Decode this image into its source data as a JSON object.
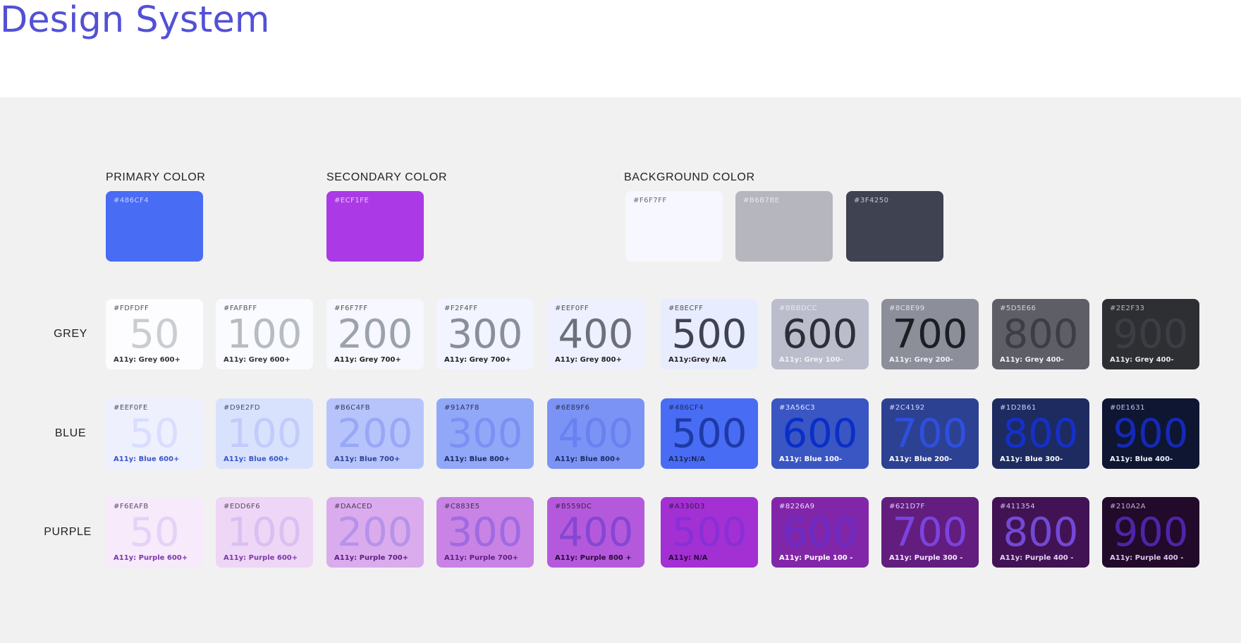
{
  "title": "Design System",
  "sections": {
    "primary": {
      "label": "PRIMARY COLOR",
      "swatches": [
        {
          "hex": "#486CF4",
          "color": "#486CF4",
          "text": "#c8d2ff"
        }
      ]
    },
    "secondary": {
      "label": "SECONDARY COLOR",
      "swatches": [
        {
          "hex": "#ECF1FE",
          "color": "#AB3AE6",
          "text": "#e7c8f7"
        }
      ]
    },
    "background": {
      "label": "BACKGROUND COLOR",
      "swatches": [
        {
          "hex": "#F6F7FF",
          "color": "#F6F7FF",
          "text": "#666b78"
        },
        {
          "hex": "#B6B7BE",
          "color": "#B6B7BE",
          "text": "#e6e7ec"
        },
        {
          "hex": "#3F4250",
          "color": "#3F4250",
          "text": "#c5c7d0"
        }
      ]
    }
  },
  "palettes": [
    {
      "label": "GREY",
      "swatches": [
        {
          "hex": "#FDFDFF",
          "num": "50",
          "ally": "A11y: Grey 600+",
          "bg": "#FDFDFF",
          "numColor": "#cacdd2",
          "hexColor": "#555",
          "allyColor": "#333"
        },
        {
          "hex": "#FAFBFF",
          "num": "100",
          "ally": "A11y: Grey 600+",
          "bg": "#FAFBFF",
          "numColor": "#b7bcc3",
          "hexColor": "#555",
          "allyColor": "#333"
        },
        {
          "hex": "#F6F7FF",
          "num": "200",
          "ally": "A11y: Grey 700+",
          "bg": "#F6F7FF",
          "numColor": "#9ca2ab",
          "hexColor": "#555",
          "allyColor": "#222"
        },
        {
          "hex": "#F2F4FF",
          "num": "300",
          "ally": "A11y: Grey 700+",
          "bg": "#F2F4FF",
          "numColor": "#888f99",
          "hexColor": "#555",
          "allyColor": "#222"
        },
        {
          "hex": "#EEF0FF",
          "num": "400",
          "ally": "A11y: Grey 800+",
          "bg": "#EEF0FF",
          "numColor": "#6b717b",
          "hexColor": "#555",
          "allyColor": "#222"
        },
        {
          "hex": "#E8ECFF",
          "num": "500",
          "ally": "A11y:Grey N/A",
          "bg": "#E8ECFF",
          "numColor": "#3f4250",
          "hexColor": "#555",
          "allyColor": "#222"
        },
        {
          "hex": "#BBBDCC",
          "num": "600",
          "ally": "A11y: Grey 100-",
          "bg": "#BBBDCC",
          "numColor": "#2d2f38",
          "hexColor": "#e8e8ee",
          "allyColor": "#f0f0f5"
        },
        {
          "hex": "#8C8E99",
          "num": "700",
          "ally": "A11y: Grey 200-",
          "bg": "#8C8E99",
          "numColor": "#1d1e24",
          "hexColor": "#e2e2ea",
          "allyColor": "#f0f0f5"
        },
        {
          "hex": "#5D5E66",
          "num": "800",
          "ally": "A11y: Grey 400-",
          "bg": "#5D5E66",
          "numColor": "#3d3e45",
          "hexColor": "#d5d5dc",
          "allyColor": "#f0f0f5"
        },
        {
          "hex": "#2E2F33",
          "num": "900",
          "ally": "A11y: Grey 400-",
          "bg": "#2E2F33",
          "numColor": "#3c3e45",
          "hexColor": "#b9bac2",
          "allyColor": "#e8e8ee"
        }
      ]
    },
    {
      "label": "BLUE",
      "swatches": [
        {
          "hex": "#EEF0FE",
          "num": "50",
          "ally": "A11y: Blue 600+",
          "bg": "#EEF0FE",
          "numColor": "#d9deff",
          "hexColor": "#4a4e66",
          "allyColor": "#3b56c3"
        },
        {
          "hex": "#D9E2FD",
          "num": "100",
          "ally": "A11y: Blue 600+",
          "bg": "#D9E2FD",
          "numColor": "#c2ccfb",
          "hexColor": "#4a4e66",
          "allyColor": "#3b56c3"
        },
        {
          "hex": "#B6C4FB",
          "num": "200",
          "ally": "A11y: Blue 700+",
          "bg": "#B6C4FB",
          "numColor": "#98a8f6",
          "hexColor": "#3a3e58",
          "allyColor": "#2c4192"
        },
        {
          "hex": "#91A7F8",
          "num": "300",
          "ally": "A11y: Blue 800+",
          "bg": "#91A7F8",
          "numColor": "#7b90f3",
          "hexColor": "#2d3150",
          "allyColor": "#1d2b61"
        },
        {
          "hex": "#6E89F6",
          "num": "400",
          "ally": "A11y: Blue 800+",
          "bg": "#7B93F5",
          "numColor": "#6881f0",
          "hexColor": "#2d3150",
          "allyColor": "#1d2b61"
        },
        {
          "hex": "#486CF4",
          "num": "500",
          "ally": "A11y:N/A",
          "bg": "#486CF4",
          "numColor": "#1e3aa8",
          "hexColor": "#1e2a5a",
          "allyColor": "#1d2b61"
        },
        {
          "hex": "#3A56C3",
          "num": "600",
          "ally": "A11y: Blue 100-",
          "bg": "#3A56C3",
          "numColor": "#0a2fc8",
          "hexColor": "#dfe5ff",
          "allyColor": "#ffffff"
        },
        {
          "hex": "#2C4192",
          "num": "700",
          "ally": "A11y: Blue 200-",
          "bg": "#2C4192",
          "numColor": "#2f4fe0",
          "hexColor": "#d3dbff",
          "allyColor": "#ffffff"
        },
        {
          "hex": "#1D2B61",
          "num": "800",
          "ally": "A11y: Blue 300-",
          "bg": "#1D2B61",
          "numColor": "#1530c9",
          "hexColor": "#c8d2ff",
          "allyColor": "#ffffff"
        },
        {
          "hex": "#0E1631",
          "num": "900",
          "ally": "A11y: Blue 400-",
          "bg": "#0E1631",
          "numColor": "#1529b8",
          "hexColor": "#b9c3f2",
          "allyColor": "#f0f3ff"
        }
      ]
    },
    {
      "label": "PURPLE",
      "swatches": [
        {
          "hex": "#F6EAFB",
          "num": "50",
          "ally": "A11y: Purple 600+",
          "bg": "#F6EAFB",
          "numColor": "#e6d2f6",
          "hexColor": "#5b4a66",
          "allyColor": "#7b3aa6"
        },
        {
          "hex": "#EDD6F6",
          "num": "100",
          "ally": "A11y: Purple 600+",
          "bg": "#EDD6F6",
          "numColor": "#d9c0f2",
          "hexColor": "#5b4a66",
          "allyColor": "#7b3aa6"
        },
        {
          "hex": "#DAACED",
          "num": "200",
          "ally": "A11y: Purple 700+",
          "bg": "#DAACED",
          "numColor": "#b792ea",
          "hexColor": "#4c3a58",
          "allyColor": "#5f1d7f"
        },
        {
          "hex": "#C883E5",
          "num": "300",
          "ally": "A11y: Purple 700+",
          "bg": "#C883E5",
          "numColor": "#9f6ae2",
          "hexColor": "#45304f",
          "allyColor": "#5f1d7f"
        },
        {
          "hex": "#B559DC",
          "num": "400",
          "ally": "A11y: Purple 800 +",
          "bg": "#B559DC",
          "numColor": "#8447d3",
          "hexColor": "#3c2447",
          "allyColor": "#2a0b3a"
        },
        {
          "hex": "#A330D3",
          "num": "500",
          "ally": "A11y: N/A",
          "bg": "#A330D3",
          "numColor": "#8a2fd6",
          "hexColor": "#3c1450",
          "allyColor": "#2a0b3a"
        },
        {
          "hex": "#8226A9",
          "num": "600",
          "ally": "A11y: Purple 100 -",
          "bg": "#8226A9",
          "numColor": "#6a2bc7",
          "hexColor": "#f0dcff",
          "allyColor": "#ffffff"
        },
        {
          "hex": "#621D7F",
          "num": "700",
          "ally": "A11y: Purple 300 -",
          "bg": "#621D7F",
          "numColor": "#7b44e0",
          "hexColor": "#e6ccf5",
          "allyColor": "#f5e8ff"
        },
        {
          "hex": "#411354",
          "num": "800",
          "ally": "A11y: Purple 400 -",
          "bg": "#411354",
          "numColor": "#7349d6",
          "hexColor": "#dcc2ec",
          "allyColor": "#e6d0f5"
        },
        {
          "hex": "#210A2A",
          "num": "900",
          "ally": "A11y: Purple 400 -",
          "bg": "#210A2A",
          "numColor": "#4f24a8",
          "hexColor": "#c7aedb",
          "allyColor": "#dcc5ee"
        }
      ]
    }
  ]
}
